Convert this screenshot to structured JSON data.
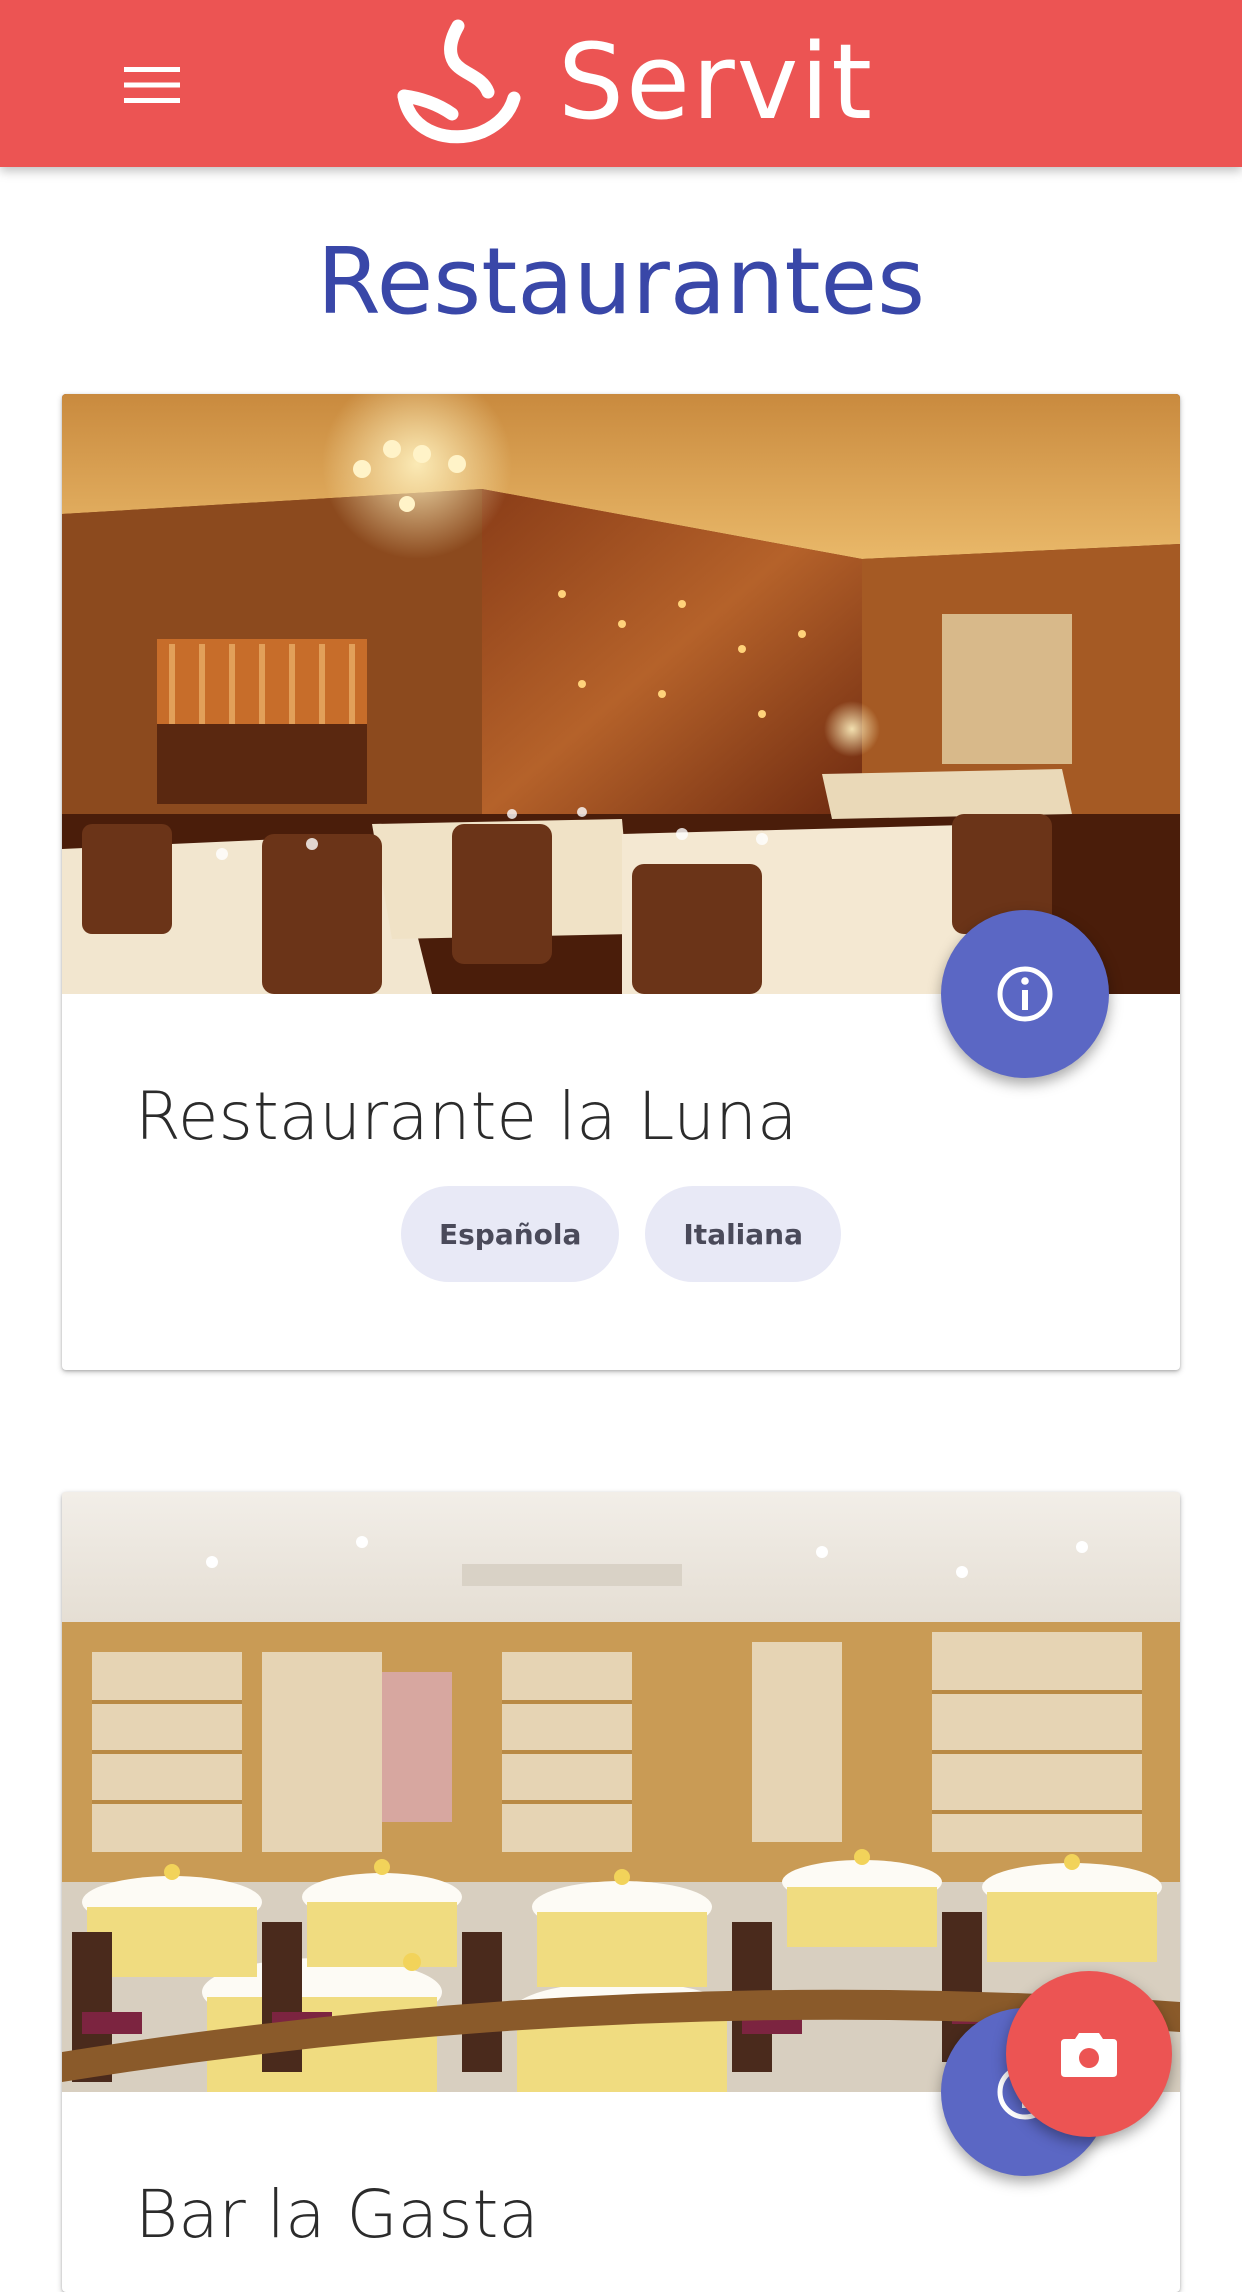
{
  "appbar": {
    "brand": "Servit",
    "menu_icon": "menu-icon",
    "brand_color": "#ec5453"
  },
  "page": {
    "title": "Restaurantes",
    "title_color": "#3947a8"
  },
  "restaurants": [
    {
      "name": "Restaurante la Luna",
      "tags": [
        "Española",
        "Italiana"
      ],
      "action_icon": "info-icon"
    },
    {
      "name": "Bar la Gasta",
      "tags": [],
      "action_icon": "info-icon"
    }
  ],
  "fab": {
    "icon": "camera-icon",
    "color": "#ec5453"
  },
  "accent": "#5b67c4"
}
